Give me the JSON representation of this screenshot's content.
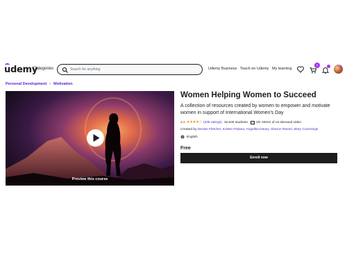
{
  "header": {
    "logo": "udemy",
    "categories": "Categories",
    "search_placeholder": "Search for anything",
    "nav": [
      "Udemy Business",
      "Teach on Udemy",
      "My learning"
    ],
    "cart_count": "1"
  },
  "breadcrumb": {
    "items": [
      "Personal Development",
      "Motivation"
    ]
  },
  "preview": {
    "label": "Preview this course"
  },
  "course": {
    "title": "Women Helping Women to Succeed",
    "subtitle": "A collection of resources created by women to empower and motivate women in support of International Women's Day",
    "rating": "4.1",
    "stars": "★★★★☆",
    "rating_count": "(339 ratings)",
    "students": "15,648 students",
    "video": "1hr 49min of on-demand video",
    "created_by_label": "Created by",
    "authors": "Denise Fletcher, Kristen Palana, Angelika Davey, Sharon Ramel, Mary Cummings",
    "language": "English",
    "price": "Free",
    "enroll_label": "Enroll now"
  },
  "colors": {
    "brand": "#a435f0",
    "link": "#5624d0",
    "star": "#e59819",
    "dark": "#1c1d1f"
  }
}
